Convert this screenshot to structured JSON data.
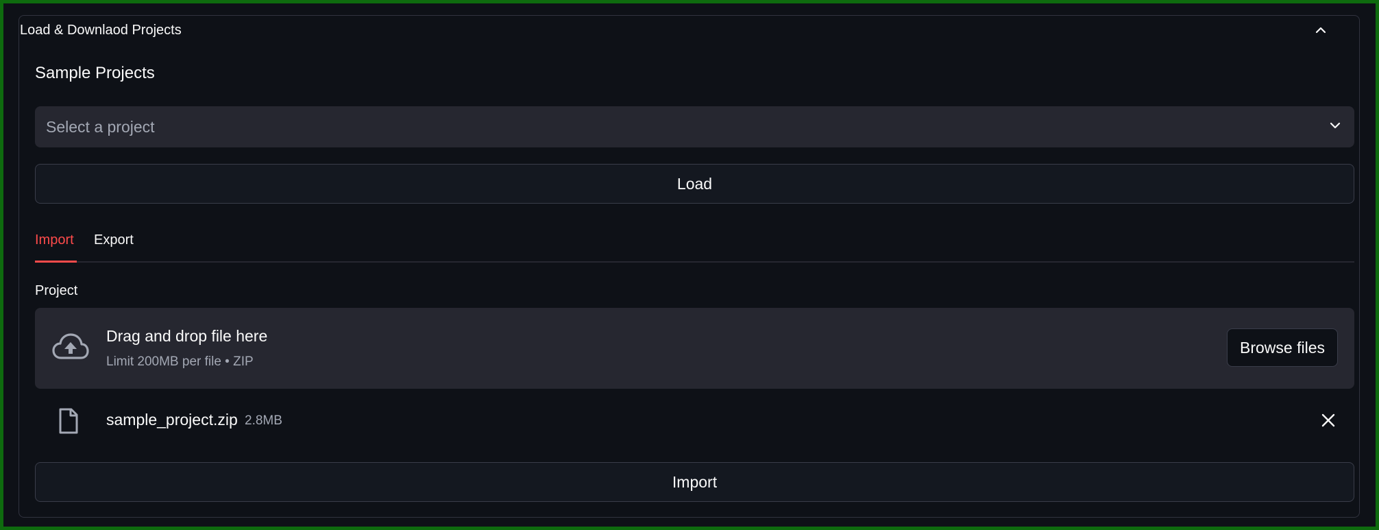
{
  "expander": {
    "title": "Load & Downlaod Projects",
    "icon": "chevron-up-icon"
  },
  "sample_projects": {
    "title": "Sample Projects",
    "select_placeholder": "Select a project",
    "load_label": "Load"
  },
  "tabs": [
    {
      "label": "Import",
      "active": true
    },
    {
      "label": "Export",
      "active": false
    }
  ],
  "uploader": {
    "label": "Project",
    "drop_title": "Drag and drop file here",
    "limit_text": "Limit 200MB per file • ZIP",
    "browse_label": "Browse files",
    "icon": "cloud-upload-icon"
  },
  "file": {
    "name": "sample_project.zip",
    "size": "2.8MB",
    "icon": "file-icon"
  },
  "import_label": "Import",
  "colors": {
    "background": "#0e1117",
    "accent": "#ff4b4b",
    "surface": "#262730",
    "text": "#fafafa",
    "muted_text": "#a3a8b4",
    "outer_frame": "#0e6b0e"
  }
}
